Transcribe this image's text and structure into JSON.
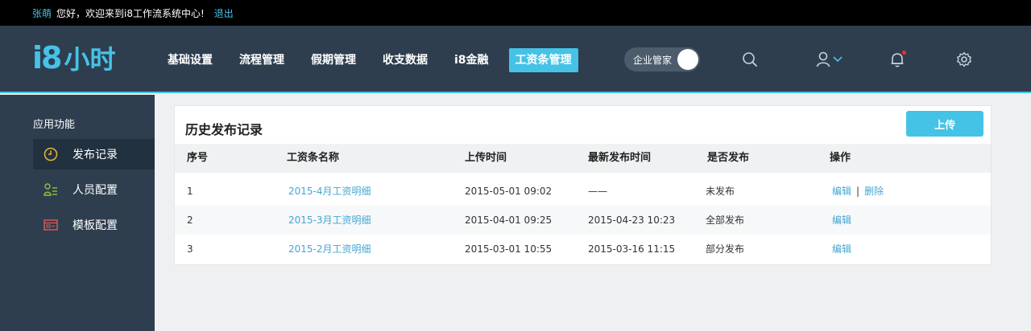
{
  "topbar": {
    "username": "张萌",
    "greeting": "您好，欢迎来到i8工作流系统中心!",
    "logout": "退出"
  },
  "header": {
    "logo_i8": "i8",
    "logo_text": "小时",
    "nav": [
      {
        "label": "基础设置",
        "active": false
      },
      {
        "label": "流程管理",
        "active": false
      },
      {
        "label": "假期管理",
        "active": false
      },
      {
        "label": "收支数据",
        "active": false
      },
      {
        "label": "i8金融",
        "active": false
      },
      {
        "label": "工资条管理",
        "active": true
      }
    ],
    "toggle_label": "企业管家",
    "icons": [
      "search-icon",
      "user-icon",
      "bell-icon",
      "gear-icon"
    ]
  },
  "sidebar": {
    "section_title": "应用功能",
    "items": [
      {
        "label": "发布记录",
        "icon": "clock-icon",
        "active": true
      },
      {
        "label": "人员配置",
        "icon": "person-list-icon",
        "active": false
      },
      {
        "label": "模板配置",
        "icon": "template-icon",
        "active": false
      }
    ]
  },
  "main": {
    "title": "历史发布记录",
    "upload_label": "上传",
    "columns": [
      "序号",
      "工资条名称",
      "上传时间",
      "最新发布时间",
      "是否发布",
      "操作"
    ],
    "rows": [
      {
        "no": "1",
        "name": "2015-4月工资明细",
        "upload": "2015-05-01 09:02",
        "latest": "——",
        "status": "未发布",
        "ops": [
          "编辑",
          "删除"
        ]
      },
      {
        "no": "2",
        "name": "2015-3月工资明细",
        "upload": "2015-04-01 09:25",
        "latest": "2015-04-23 10:23",
        "status": "全部发布",
        "ops": [
          "编辑"
        ]
      },
      {
        "no": "3",
        "name": "2015-2月工资明细",
        "upload": "2015-03-01 10:55",
        "latest": "2015-03-16 11:15",
        "status": "部分发布",
        "ops": [
          "编辑"
        ]
      }
    ],
    "op_separator": "|"
  },
  "colors": {
    "accent": "#45c3e6",
    "header_bg": "#2e3e4f",
    "link": "#45a7d2",
    "notify_dot": "#ff2a2a"
  }
}
